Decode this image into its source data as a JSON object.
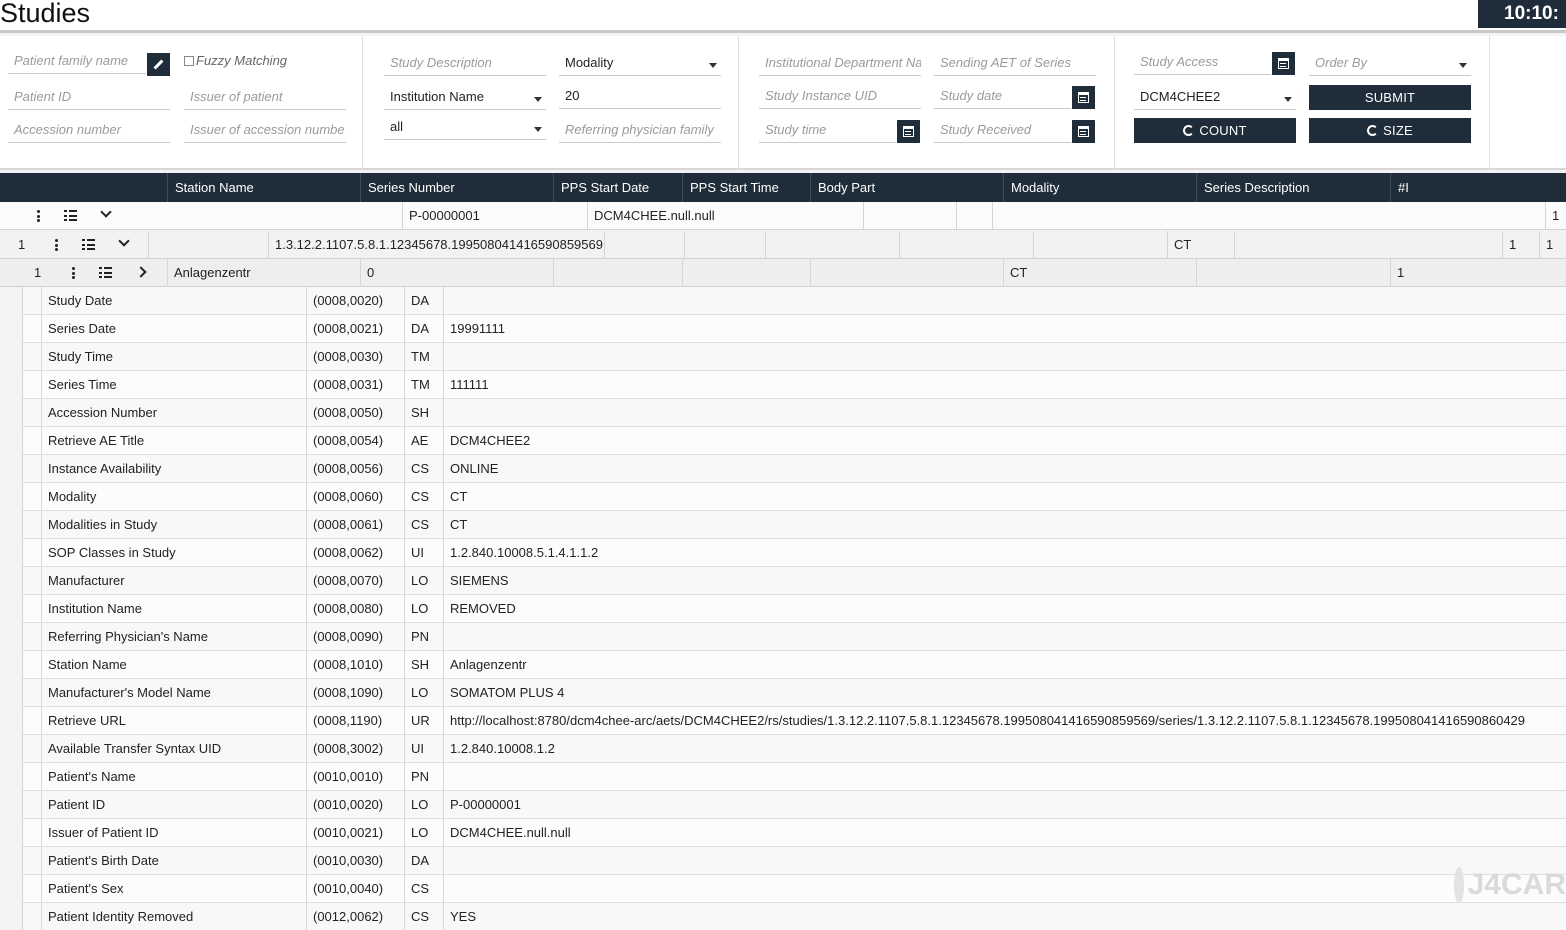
{
  "header": {
    "title": "Studies",
    "clock": "10:10:"
  },
  "filters": {
    "patient_family_name": "Patient family name",
    "fuzzy_matching": "Fuzzy Matching",
    "patient_id": "Patient ID",
    "issuer_of_patient": "Issuer of patient",
    "accession_number": "Accession number",
    "issuer_of_accession": "Issuer of accession numbe",
    "study_description": "Study Description",
    "modality": "Modality",
    "institution_name": "Institution Name",
    "limit": "20",
    "all": "all",
    "referring_physician": "Referring physician family",
    "institutional_department": "Institutional Department Na",
    "sending_aet": "Sending AET of Series",
    "study_instance_uid": "Study Instance UID",
    "study_date": "Study date",
    "study_time": "Study time",
    "study_received": "Study Received",
    "study_access": "Study Access",
    "order_by": "Order By",
    "aet": "DCM4CHEE2",
    "submit": "SUBMIT",
    "count": "COUNT",
    "size": "SIZE"
  },
  "series_header": [
    "Station Name",
    "Series Number",
    "PPS Start Date",
    "PPS Start Time",
    "Body Part",
    "Modality",
    "Series Description",
    "#I"
  ],
  "patient_row": {
    "patient_id": "P-00000001",
    "issuer": "DCM4CHEE.null.null",
    "count": "1"
  },
  "study_row": {
    "index": "1",
    "uid": "1.3.12.2.1107.5.8.1.12345678.199508041416590859569",
    "modality": "CT",
    "count1": "1",
    "count2": "1"
  },
  "series_row": {
    "index": "1",
    "station": "Anlagenzentr",
    "series_number": "0",
    "modality": "CT",
    "count": "1"
  },
  "attributes": [
    {
      "name": "Study Date",
      "tag": "(0008,0020)",
      "vr": "DA",
      "value": ""
    },
    {
      "name": "Series Date",
      "tag": "(0008,0021)",
      "vr": "DA",
      "value": "19991111"
    },
    {
      "name": "Study Time",
      "tag": "(0008,0030)",
      "vr": "TM",
      "value": ""
    },
    {
      "name": "Series Time",
      "tag": "(0008,0031)",
      "vr": "TM",
      "value": "111111"
    },
    {
      "name": "Accession Number",
      "tag": "(0008,0050)",
      "vr": "SH",
      "value": ""
    },
    {
      "name": "Retrieve AE Title",
      "tag": "(0008,0054)",
      "vr": "AE",
      "value": "DCM4CHEE2"
    },
    {
      "name": "Instance Availability",
      "tag": "(0008,0056)",
      "vr": "CS",
      "value": "ONLINE"
    },
    {
      "name": "Modality",
      "tag": "(0008,0060)",
      "vr": "CS",
      "value": "CT"
    },
    {
      "name": "Modalities in Study",
      "tag": "(0008,0061)",
      "vr": "CS",
      "value": "CT"
    },
    {
      "name": "SOP Classes in Study",
      "tag": "(0008,0062)",
      "vr": "UI",
      "value": "1.2.840.10008.5.1.4.1.1.2"
    },
    {
      "name": "Manufacturer",
      "tag": "(0008,0070)",
      "vr": "LO",
      "value": "SIEMENS"
    },
    {
      "name": "Institution Name",
      "tag": "(0008,0080)",
      "vr": "LO",
      "value": "REMOVED"
    },
    {
      "name": "Referring Physician's Name",
      "tag": "(0008,0090)",
      "vr": "PN",
      "value": ""
    },
    {
      "name": "Station Name",
      "tag": "(0008,1010)",
      "vr": "SH",
      "value": "Anlagenzentr"
    },
    {
      "name": "Manufacturer's Model Name",
      "tag": "(0008,1090)",
      "vr": "LO",
      "value": "SOMATOM PLUS 4"
    },
    {
      "name": "Retrieve URL",
      "tag": "(0008,1190)",
      "vr": "UR",
      "value": "http://localhost:8780/dcm4chee-arc/aets/DCM4CHEE2/rs/studies/1.3.12.2.1107.5.8.1.12345678.199508041416590859569/series/1.3.12.2.1107.5.8.1.12345678.199508041416590860429"
    },
    {
      "name": "Available Transfer Syntax UID",
      "tag": "(0008,3002)",
      "vr": "UI",
      "value": "1.2.840.10008.1.2"
    },
    {
      "name": "Patient's Name",
      "tag": "(0010,0010)",
      "vr": "PN",
      "value": ""
    },
    {
      "name": "Patient ID",
      "tag": "(0010,0020)",
      "vr": "LO",
      "value": "P-00000001"
    },
    {
      "name": "Issuer of Patient ID",
      "tag": "(0010,0021)",
      "vr": "LO",
      "value": "DCM4CHEE.null.null"
    },
    {
      "name": "Patient's Birth Date",
      "tag": "(0010,0030)",
      "vr": "DA",
      "value": ""
    },
    {
      "name": "Patient's Sex",
      "tag": "(0010,0040)",
      "vr": "CS",
      "value": ""
    },
    {
      "name": "Patient Identity Removed",
      "tag": "(0012,0062)",
      "vr": "CS",
      "value": "YES"
    }
  ],
  "watermark": "J4CAR",
  "colors": {
    "dark": "#1f2d3a",
    "accent": "#ffffff"
  }
}
